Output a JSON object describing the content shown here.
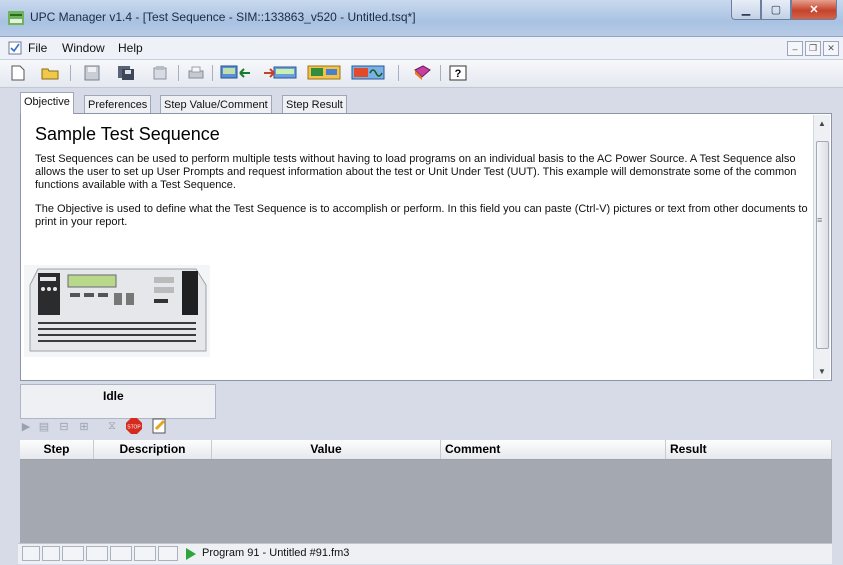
{
  "window": {
    "title": "UPC Manager v1.4 - [Test Sequence - SIM::133863_v520 - Untitled.tsq*]",
    "minimize_icon": "minimize-icon",
    "maximize_icon": "maximize-icon",
    "close_icon": "close-icon"
  },
  "menu": {
    "items": [
      "File",
      "Window",
      "Help"
    ]
  },
  "tabs": [
    "Objective",
    "Preferences",
    "Step Value/Comment",
    "Step Result"
  ],
  "objective": {
    "title": "Sample Test Sequence",
    "paragraph1": "Test Sequences can be used to perform multiple tests without having to load programs on an individual basis to the AC Power Source. A Test Sequence also allows the user to set up User Prompts and request information about the test or Unit Under Test (UUT). This example will demonstrate some of the common functions available with a Test Sequence.",
    "paragraph2": "The Objective is used to define what the Test Sequence is to accomplish or perform. In this field you can paste (Ctrl-V) pictures or text from other documents to print in your report."
  },
  "run_status": "Idle",
  "columns": [
    "Step",
    "Description",
    "Value",
    "Comment",
    "Result"
  ],
  "statusbar": {
    "program": "Program 91 - Untitled #91.fm3"
  },
  "colors": {
    "accent": "#2ea53a",
    "close": "#c5432b",
    "stop": "#d52b1e"
  }
}
